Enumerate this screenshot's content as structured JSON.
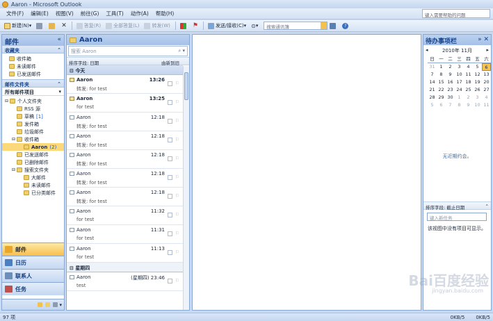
{
  "window": {
    "title": "Aaron - Microsoft Outlook"
  },
  "menu": {
    "items": [
      "文件(F)",
      "编辑(E)",
      "视图(V)",
      "前往(G)",
      "工具(T)",
      "动作(A)",
      "帮助(H)"
    ],
    "help_placeholder": "键入需要帮助的问题"
  },
  "toolbar": {
    "new": "新建(N)",
    "reply": "答复(R)",
    "reply_all": "全部答复(L)",
    "forward": "转发(W)",
    "send_receive": "发送/接收(C)",
    "search_placeholder": "搜索通讯簿"
  },
  "nav": {
    "title": "邮件",
    "favorites_title": "收藏夹",
    "favorites": [
      "收件箱",
      "未读邮件",
      "已发送邮件"
    ],
    "folders_title": "邮件文件夹",
    "all_mail": "所有邮件项目",
    "tree": [
      {
        "label": "个人文件夹",
        "count": "",
        "indent": 0
      },
      {
        "label": "RSS 源",
        "count": "",
        "indent": 1
      },
      {
        "label": "草稿",
        "count": "[1]",
        "indent": 1
      },
      {
        "label": "发件箱",
        "count": "",
        "indent": 1
      },
      {
        "label": "垃圾邮件",
        "count": "",
        "indent": 1
      },
      {
        "label": "收件箱",
        "count": "",
        "indent": 1
      },
      {
        "label": "Aaron",
        "count": "(2)",
        "indent": 2,
        "selected": true
      },
      {
        "label": "已发送邮件",
        "count": "",
        "indent": 1
      },
      {
        "label": "已删除邮件",
        "count": "",
        "indent": 1
      },
      {
        "label": "搜索文件夹",
        "count": "",
        "indent": 1
      },
      {
        "label": "大邮件",
        "count": "",
        "indent": 2
      },
      {
        "label": "未读邮件",
        "count": "",
        "indent": 2
      },
      {
        "label": "已分类邮件",
        "count": "",
        "indent": 2
      }
    ],
    "buttons": [
      {
        "label": "邮件",
        "color": "#e8a62a"
      },
      {
        "label": "日历",
        "color": "#4a7fc1"
      },
      {
        "label": "联系人",
        "color": "#6b8fb8"
      },
      {
        "label": "任务",
        "color": "#c0504d"
      }
    ]
  },
  "list": {
    "title": "Aaron",
    "search_placeholder": "搜索 Aaron",
    "sort_label": "排序字段: 日期",
    "sort_order": "由新到旧",
    "groups": [
      {
        "label": "今天",
        "messages": [
          {
            "from": "Aaron",
            "time": "13:26",
            "subject": "转发: for test",
            "unread": true
          },
          {
            "from": "Aaron",
            "time": "13:25",
            "subject": "for test",
            "unread": true
          },
          {
            "from": "Aaron",
            "time": "12:18",
            "subject": "转发: for test",
            "unread": false
          },
          {
            "from": "Aaron",
            "time": "12:18",
            "subject": "转发: for test",
            "unread": false
          },
          {
            "from": "Aaron",
            "time": "12:18",
            "subject": "转发: for test",
            "unread": false
          },
          {
            "from": "Aaron",
            "time": "12:18",
            "subject": "转发: for test",
            "unread": false
          },
          {
            "from": "Aaron",
            "time": "12:18",
            "subject": "转发: for test",
            "unread": false
          },
          {
            "from": "Aaron",
            "time": "11:32",
            "subject": "for test",
            "unread": false
          },
          {
            "from": "Aaron",
            "time": "11:31",
            "subject": "for test",
            "unread": false
          },
          {
            "from": "Aaron",
            "time": "11:13",
            "subject": "for test",
            "unread": false
          }
        ]
      },
      {
        "label": "星期四",
        "messages": [
          {
            "from": "Aaron",
            "time": "(星期四) 23:46",
            "subject": "test",
            "unread": false
          }
        ]
      }
    ]
  },
  "todo": {
    "title": "待办事项栏",
    "month": "2010年 11月",
    "weekdays": [
      "日",
      "一",
      "二",
      "三",
      "四",
      "五",
      "六"
    ],
    "weeks": [
      [
        "31",
        "1",
        "2",
        "3",
        "4",
        "5",
        "6"
      ],
      [
        "7",
        "8",
        "9",
        "10",
        "11",
        "12",
        "13"
      ],
      [
        "14",
        "15",
        "16",
        "17",
        "18",
        "19",
        "20"
      ],
      [
        "21",
        "22",
        "23",
        "24",
        "25",
        "26",
        "27"
      ],
      [
        "28",
        "29",
        "30",
        "1",
        "2",
        "3",
        "4"
      ],
      [
        "5",
        "6",
        "7",
        "8",
        "9",
        "10",
        "11"
      ]
    ],
    "today": "6",
    "no_appointments": "无近期约会。",
    "task_sort": "排序字段: 截止日期",
    "new_task_placeholder": "键入新任务",
    "no_tasks": "该视图中没有项目可显示。"
  },
  "status": {
    "items": "97 项",
    "rate1": "0KB/5",
    "rate2": "0KB/5"
  },
  "watermark": {
    "brand": "Bai百度经验",
    "url": "jingyan.baidu.com"
  }
}
